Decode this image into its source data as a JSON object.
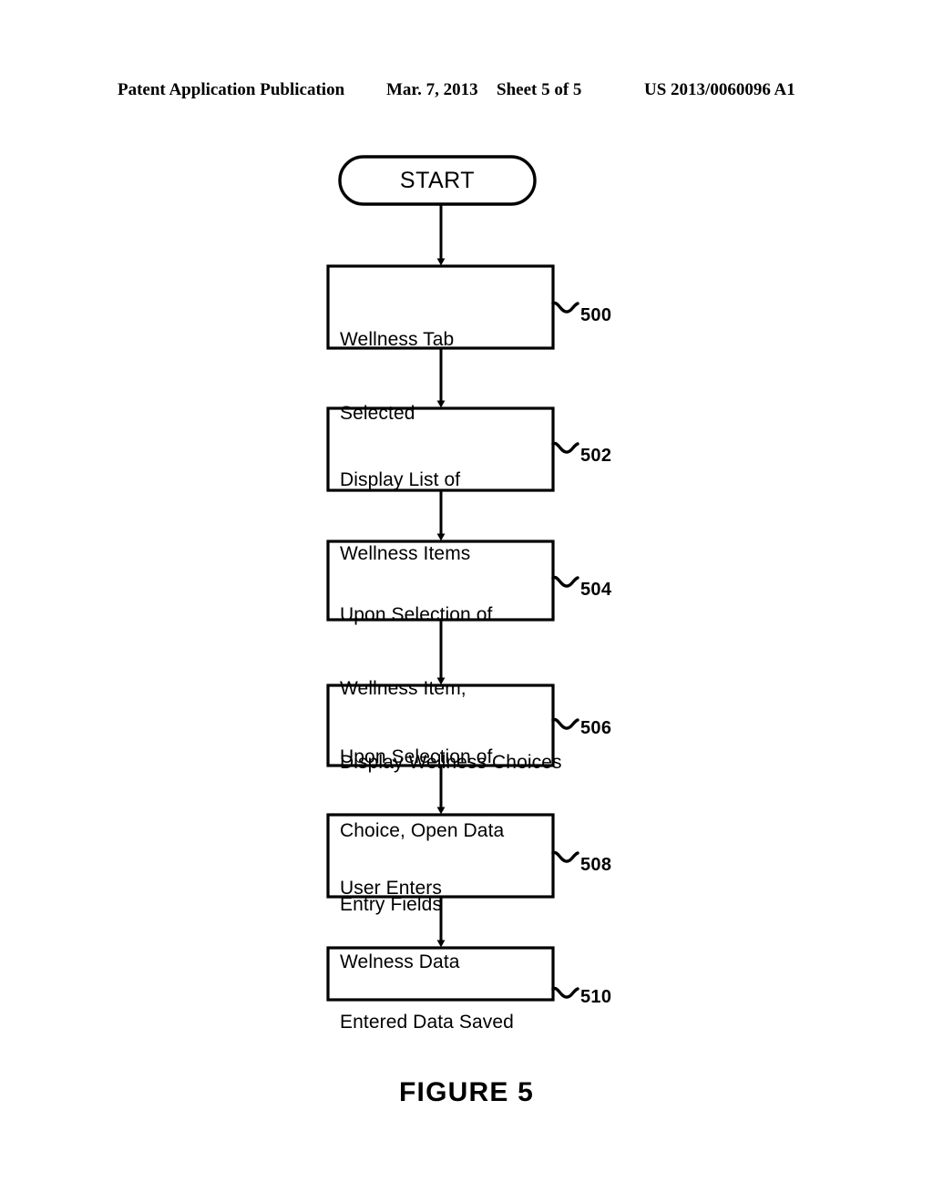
{
  "header": {
    "publication": "Patent Application Publication",
    "date": "Mar. 7, 2013",
    "sheet": "Sheet 5 of 5",
    "patent_number": "US 2013/0060096 A1"
  },
  "figure": {
    "caption": "FIGURE 5",
    "start_node": {
      "label": "START",
      "shape": "stadium"
    },
    "steps": [
      {
        "ref": "500",
        "lines": [
          "Wellness Tab",
          "Selected"
        ],
        "shape": "rectangle"
      },
      {
        "ref": "502",
        "lines": [
          "Display List of",
          "Wellness Items"
        ],
        "shape": "rectangle"
      },
      {
        "ref": "504",
        "lines": [
          "Upon Selection of",
          "Wellness Item,",
          "Display Wellness Choices"
        ],
        "shape": "rectangle"
      },
      {
        "ref": "506",
        "lines": [
          "Upon Selection of",
          "Choice, Open Data",
          "Entry Fields"
        ],
        "shape": "rectangle"
      },
      {
        "ref": "508",
        "lines": [
          "User Enters",
          "Welness Data"
        ],
        "shape": "rectangle"
      },
      {
        "ref": "510",
        "lines": [
          "Entered Data Saved"
        ],
        "shape": "rectangle"
      }
    ]
  },
  "style": {
    "ink": "#000000",
    "paper": "#ffffff"
  }
}
